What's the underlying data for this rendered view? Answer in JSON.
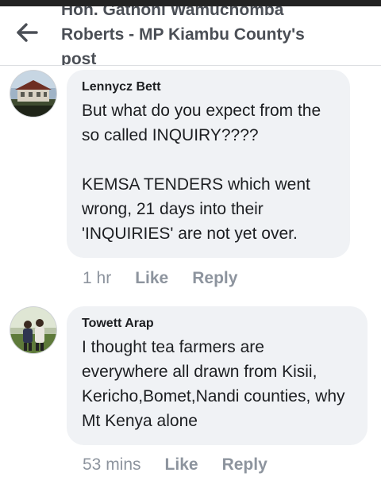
{
  "header": {
    "title": "Hon. Gathoni Wamuchomba Roberts - MP Kiambu County's post",
    "back_icon": "arrow-left-icon"
  },
  "comments": [
    {
      "author": "Lennycz Bett",
      "text": "But what do you expect from the so called INQUIRY????\n\nKEMSA TENDERS which went wrong, 21 days into their 'INQUIRIES' are not yet over.",
      "time": "1 hr",
      "like_label": "Like",
      "reply_label": "Reply"
    },
    {
      "author": "Towett Arap",
      "text": "I thought tea farmers are everywhere all drawn from Kisii, Kericho,Bomet,Nandi counties, why Mt Kenya alone",
      "time": "53 mins",
      "like_label": "Like",
      "reply_label": "Reply"
    }
  ],
  "colors": {
    "bubble": "#f0f2f5",
    "meta_text": "#8d949e",
    "header_text": "#4b4f56"
  }
}
